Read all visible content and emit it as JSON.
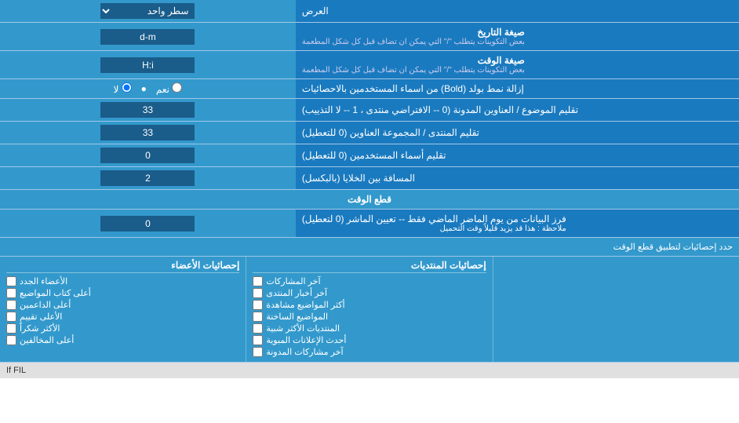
{
  "header": {
    "label_col_width": "30%",
    "input_col_width": "70%"
  },
  "rows": [
    {
      "id": "row_display",
      "label": "العرض",
      "input_type": "select",
      "value": "سطر واحد"
    },
    {
      "id": "row_date_format",
      "label_main": "صيغة التاريخ",
      "label_sub": "بعض التكوينات يتطلب \"/\" التي يمكن ان تضاف قبل كل شكل المطعمة",
      "input_type": "text",
      "value": "d-m"
    },
    {
      "id": "row_time_format",
      "label_main": "صيغة الوقت",
      "label_sub": "بعض التكوينات يتطلب \"/\" التي يمكن ان تضاف قبل كل شكل المطعمة",
      "input_type": "text",
      "value": "H:i"
    },
    {
      "id": "row_bold",
      "label": "إزالة نمط بولد (Bold) من اسماء المستخدمين بالاحصائيات",
      "input_type": "radio",
      "option_yes": "نعم",
      "option_no": "لا",
      "selected": "no"
    },
    {
      "id": "row_topic_titles",
      "label": "تقليم الموضوع / العناوين المدونة (0 -- الافتراضي منتدى ، 1 -- لا التذييب)",
      "input_type": "text",
      "value": "33"
    },
    {
      "id": "row_forum_titles",
      "label": "تقليم المنتدى / المجموعة العناوين (0 للتعطيل)",
      "input_type": "text",
      "value": "33"
    },
    {
      "id": "row_usernames",
      "label": "تقليم أسماء المستخدمين (0 للتعطيل)",
      "input_type": "text",
      "value": "0"
    },
    {
      "id": "row_spacing",
      "label": "المسافة بين الخلايا (بالبكسل)",
      "input_type": "text",
      "value": "2"
    }
  ],
  "section_cutoff": {
    "header": "قطع الوقت",
    "row_label_main": "فرز البيانات من يوم الماضر الماضي فقط -- تعيين الماشر (0 لتعطيل)",
    "row_label_note": "ملاحظة : هذا قد يزيد قليلاً وقت التحميل",
    "value": "0"
  },
  "limit_row": {
    "text": "حدد إحصائيات لتطبيق قطع الوقت"
  },
  "checkboxes": {
    "col1_header": "إحصائيات الأعضاء",
    "col1_items": [
      "الأعضاء الجدد",
      "أعلى كتاب المواضيع",
      "أعلى الداعمين",
      "الأعلى تقييم",
      "الأكثر شكراً",
      "أعلى المخالفين"
    ],
    "col2_header": "إحصائيات المنتديات",
    "col2_items": [
      "آخر المشاركات",
      "آخر أخبار المنتدى",
      "أكثر المواضيع مشاهدة",
      "المواضيع الساخنة",
      "المنتديات الأكثر شبية",
      "أحدث الإعلانات المبوية",
      "آخر مشاركات المدونة"
    ],
    "col3_label": ""
  },
  "footer_text": "If FIL"
}
